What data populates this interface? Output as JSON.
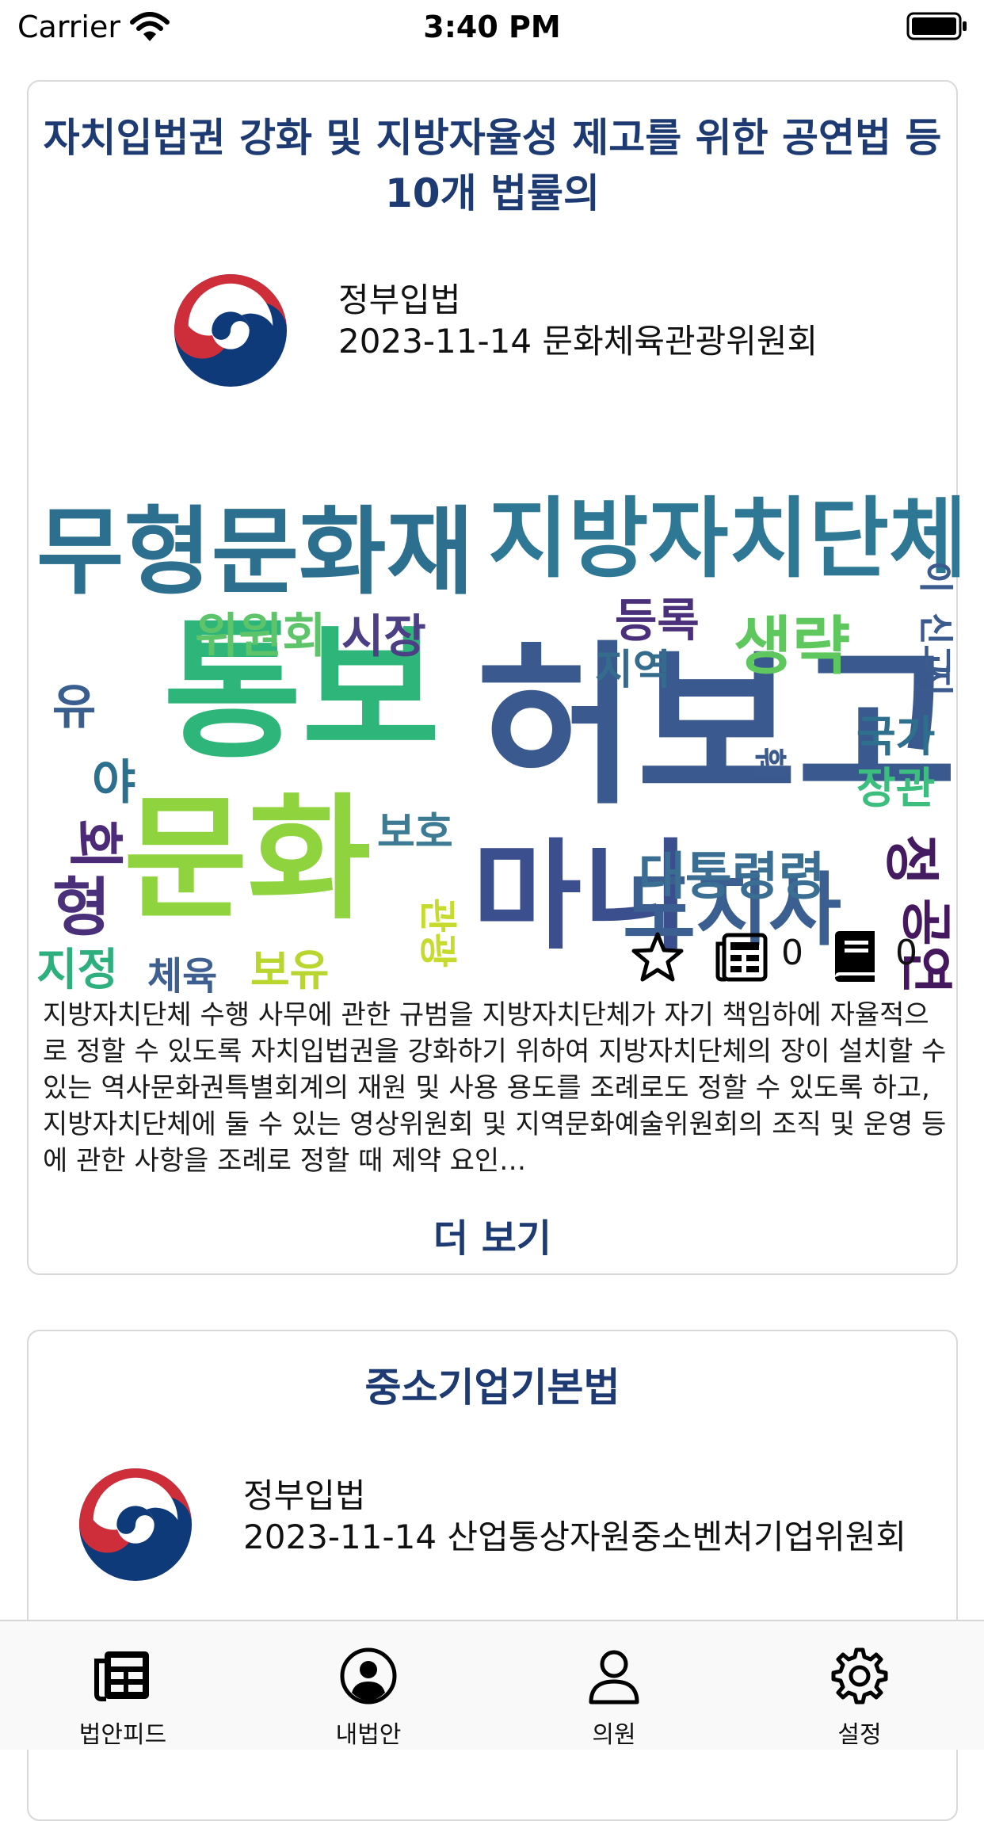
{
  "status_bar": {
    "carrier": "Carrier",
    "time": "3:40 PM",
    "icons": [
      "wifi-icon",
      "battery-icon"
    ]
  },
  "feed": [
    {
      "title": "자치입법권 강화 및 지방자율성 제고를 위한 공연법 등 10개 법률의",
      "proposer": "정부입법",
      "date_committee": "2023-11-14 문화체육관광위원회",
      "wordcloud_words": [
        "무형문화재",
        "지방자치단체",
        "통보",
        "허보고",
        "문화",
        "마니",
        "도지사",
        "위원회",
        "시장",
        "등록",
        "생략",
        "지역",
        "국가",
        "장관",
        "대통령령",
        "보호",
        "관광",
        "지정",
        "체육",
        "보유",
        "유",
        "형",
        "정",
        "공연",
        "회",
        "신고",
        "야",
        "이",
        "지",
        "훼"
      ],
      "counts": {
        "news": "0",
        "docs": "0"
      },
      "summary": "지방자치단체 수행 사무에 관한 규범을 지방자치단체가 자기 책임하에 자율적으로 정할 수 있도록 자치입법권을 강화하기 위하여 지방자치단체의 장이 설치할 수 있는 역사문화권특별회계의 재원 및 사용 용도를 조례로도 정할 수 있도록 하고, 지방자치단체에 둘 수 있는 영상위원회 및 지역문화예술위원회의 조직 및 운영 등에 관한 사항을 조례로 정할 때 제약 요인…",
      "more_label": "더 보기"
    },
    {
      "title": "중소기업기본법",
      "proposer": "정부입법",
      "date_committee": "2023-11-14 산업통상자원중소벤처기업위원회"
    }
  ],
  "tabs": [
    {
      "label": "법안피드",
      "icon": "newspaper-icon",
      "active": true
    },
    {
      "label": "내법안",
      "icon": "user-circle-icon",
      "active": false
    },
    {
      "label": "의원",
      "icon": "person-icon",
      "active": false
    },
    {
      "label": "설정",
      "icon": "gear-icon",
      "active": false
    }
  ],
  "colors": {
    "title": "#1e3a72",
    "emblem_red": "#cd2e3a",
    "emblem_blue": "#0f3a7a"
  }
}
